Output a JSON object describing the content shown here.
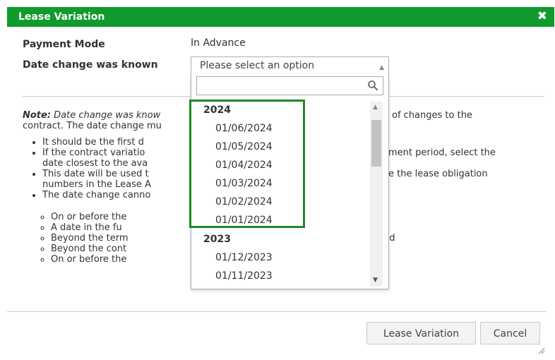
{
  "dialog": {
    "title": "Lease Variation",
    "close_icon": "close-icon"
  },
  "fields": {
    "payment_mode_label": "Payment Mode",
    "payment_mode_value": "In Advance",
    "date_change_label": "Date change was known"
  },
  "select": {
    "placeholder": "Please select an option",
    "search_value": "",
    "groups": [
      {
        "label": "2024",
        "options": [
          "01/06/2024",
          "01/05/2024",
          "01/04/2024",
          "01/03/2024",
          "01/02/2024",
          "01/01/2024"
        ]
      },
      {
        "label": "2023",
        "options": [
          "01/12/2023",
          "01/11/2023"
        ]
      }
    ]
  },
  "note": {
    "bold": "Note:",
    "italic_text": " Date change was know",
    "line1_tail": "of changes to the",
    "line2": "contract. The date change mu",
    "bullets": [
      {
        "left": "It should be the first d",
        "right": ""
      },
      {
        "left": "If the contract variatio",
        "right": "ment period, select the"
      },
      {
        "left": "date closest to the ava",
        "right": ""
      },
      {
        "left": "This date will be used t",
        "right": "e the lease obligation"
      },
      {
        "left": "numbers in the Lease A",
        "right": ""
      },
      {
        "left": "The date change canno",
        "right": ""
      }
    ],
    "sub_bullets": [
      {
        "left": "On or before the",
        "right": ""
      },
      {
        "left": "A date in the fu",
        "right": ""
      },
      {
        "left": "Beyond the term",
        "right": "nated"
      },
      {
        "left": "Beyond the cont",
        "right": ""
      },
      {
        "left": "On or before the",
        "right": ""
      }
    ]
  },
  "buttons": {
    "lease_variation": "Lease Variation",
    "cancel": "Cancel"
  },
  "colors": {
    "title_bar": "#119B2C",
    "highlight_border": "#1E8A22"
  }
}
